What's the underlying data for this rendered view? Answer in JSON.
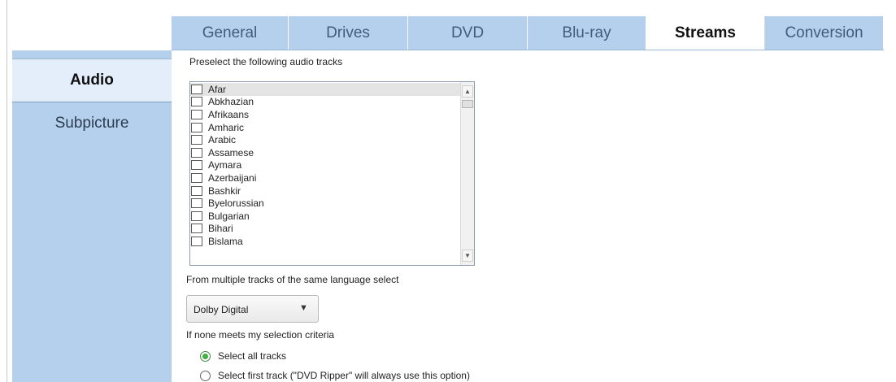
{
  "tabs": [
    {
      "label": "General",
      "active": false
    },
    {
      "label": "Drives",
      "active": false
    },
    {
      "label": "DVD",
      "active": false
    },
    {
      "label": "Blu-ray",
      "active": false
    },
    {
      "label": "Streams",
      "active": true
    },
    {
      "label": "Conversion",
      "active": false
    }
  ],
  "sidebar": {
    "items": [
      {
        "label": "Audio",
        "active": true
      },
      {
        "label": "Subpicture",
        "active": false
      }
    ]
  },
  "audio": {
    "preselect_label": "Preselect the following audio tracks",
    "languages": [
      "Afar",
      "Abkhazian",
      "Afrikaans",
      "Amharic",
      "Arabic",
      "Assamese",
      "Aymara",
      "Azerbaijani",
      "Bashkir",
      "Byelorussian",
      "Bulgarian",
      "Bihari",
      "Bislama"
    ],
    "multiple_tracks_label": "From multiple tracks of the same language select",
    "format_select": {
      "value": "Dolby Digital"
    },
    "none_meets_label": "If none meets my selection criteria",
    "options": [
      {
        "label": "Select all tracks",
        "selected": true
      },
      {
        "label": "Select first track (\"DVD Ripper\" will always use this option)",
        "selected": false
      }
    ]
  },
  "icons": {
    "scroll_up": "scroll-up-arrow-icon",
    "scroll_down": "scroll-down-arrow-icon",
    "dropdown": "chevron-down-icon"
  },
  "colors": {
    "tab_background": "#b5d0ec",
    "sidebar_active": "#e4eefa",
    "radio_selected": "#3fb13f"
  }
}
